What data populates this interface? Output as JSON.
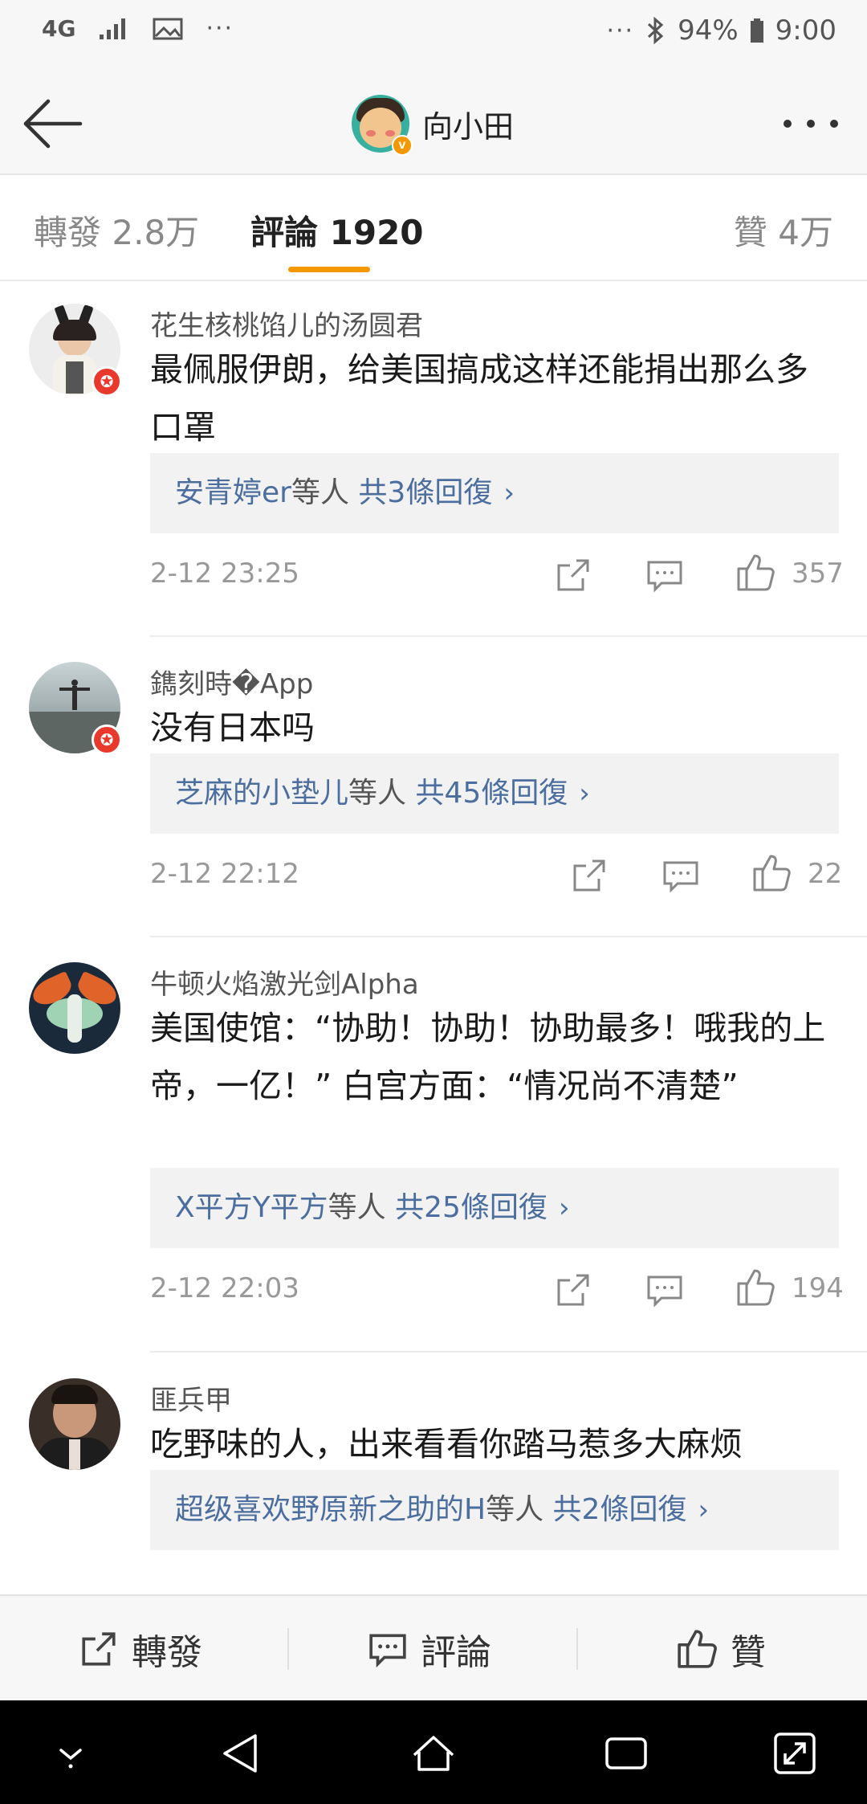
{
  "status_bar": {
    "network": "4G",
    "dots_left": "···",
    "dots_right": "···",
    "battery": "94%",
    "time": "9:00"
  },
  "header": {
    "title": "向小田",
    "verified_badge": "v"
  },
  "tabs": [
    {
      "label": "轉發",
      "count": "2.8万"
    },
    {
      "label": "評論",
      "count": "1920"
    },
    {
      "label": "贊",
      "count": "4万"
    }
  ],
  "comments": [
    {
      "user": "花生核桃馅儿的汤圆君",
      "text": "最佩服伊朗，给美国搞成这样还能捐出那么多口罩",
      "replies_names": "安青婷er",
      "replies_rest": "等人",
      "replies_count": "共3條回復",
      "time": "2-12 23:25",
      "likes": "357"
    },
    {
      "user": "鐫刻時�App",
      "text": "没有日本吗",
      "replies_names": "芝麻的小垫儿",
      "replies_rest": "等人",
      "replies_count": "共45條回復",
      "time": "2-12 22:12",
      "likes": "22"
    },
    {
      "user": "牛顿火焰激光剑Alpha",
      "text": "美国使馆：“协助！协助！协助最多！哦我的上帝，一亿！” 白宫方面：“情况尚不清楚”",
      "replies_names": "X平方Y平方",
      "replies_rest": "等人",
      "replies_count": "共25條回復",
      "time": "2-12 22:03",
      "likes": "194"
    },
    {
      "user": "匪兵甲",
      "text": "吃野味的人，出来看看你踏马惹多大麻烦",
      "replies_names": "超级喜欢野原新之助的H",
      "replies_rest": "等人",
      "replies_count": "共2條回復",
      "time": "",
      "likes": ""
    }
  ],
  "bottom_bar": {
    "repost": "轉發",
    "comment": "評論",
    "like": "贊"
  },
  "icons": {
    "back": "back-arrow-icon",
    "more": "more-dots-icon",
    "share": "share-icon",
    "comment": "comment-icon",
    "like": "thumbs-up-icon"
  },
  "colors": {
    "accent": "#f39800",
    "link": "#4b6e9e",
    "badge_red": "#e8392c"
  }
}
